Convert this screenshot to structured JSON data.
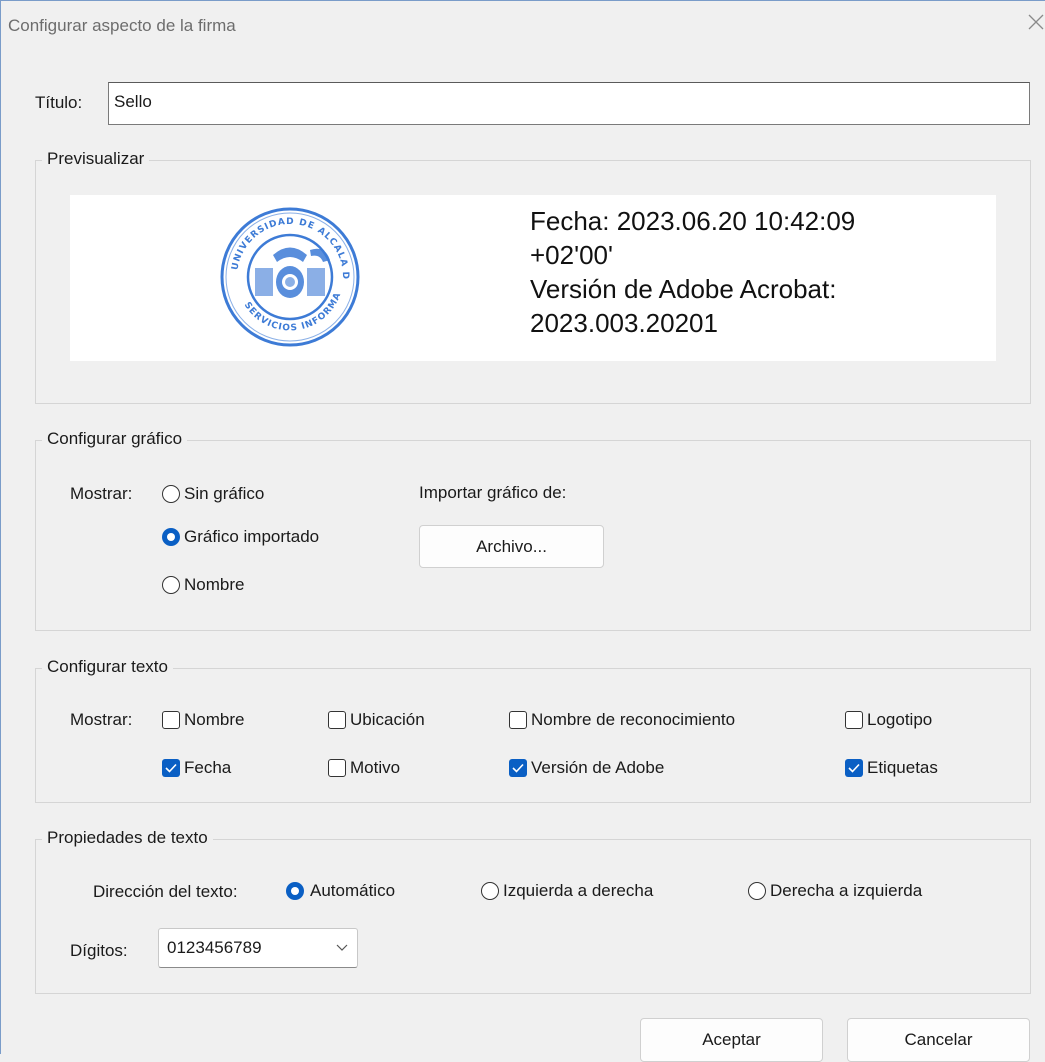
{
  "window": {
    "title": "Configurar aspecto de la firma",
    "close_icon": "close-icon"
  },
  "titulo": {
    "label": "Título:",
    "value": "Sello"
  },
  "preview": {
    "group_label": "Previsualizar",
    "seal_text": "UNIVERSIDAD DE ALCALA DE HENARES · SERVICIOS INFORMATICOS",
    "lines": [
      "Fecha: 2023.06.20 10:42:09",
      "+02'00'",
      "Versión de Adobe Acrobat:",
      "2023.003.20201"
    ],
    "seal_color": "#3d7bd6"
  },
  "graphic": {
    "group_label": "Configurar gráfico",
    "show_label": "Mostrar:",
    "options": [
      {
        "label": "Sin gráfico",
        "checked": false
      },
      {
        "label": "Gráfico importado",
        "checked": true
      },
      {
        "label": "Nombre",
        "checked": false
      }
    ],
    "import_label": "Importar gráfico de:",
    "file_button": "Archivo..."
  },
  "text_config": {
    "group_label": "Configurar texto",
    "show_label": "Mostrar:",
    "checkboxes": [
      {
        "label": "Nombre",
        "checked": false
      },
      {
        "label": "Ubicación",
        "checked": false
      },
      {
        "label": "Nombre de reconocimiento",
        "checked": false
      },
      {
        "label": "Logotipo",
        "checked": false
      },
      {
        "label": "Fecha",
        "checked": true
      },
      {
        "label": "Motivo",
        "checked": false
      },
      {
        "label": "Versión de Adobe",
        "checked": true
      },
      {
        "label": "Etiquetas",
        "checked": true
      }
    ]
  },
  "text_props": {
    "group_label": "Propiedades de texto",
    "direction_label": "Dirección del texto:",
    "direction_options": [
      {
        "label": "Automático",
        "checked": true
      },
      {
        "label": "Izquierda a derecha",
        "checked": false
      },
      {
        "label": "Derecha a izquierda",
        "checked": false
      }
    ],
    "digits_label": "Dígitos:",
    "digits_value": "0123456789"
  },
  "footer": {
    "ok_button": "Aceptar",
    "cancel_button": "Cancelar"
  },
  "colors": {
    "accent": "#0a5fc4",
    "window_border": "#7a9cc9",
    "background": "#f0f0f0"
  }
}
